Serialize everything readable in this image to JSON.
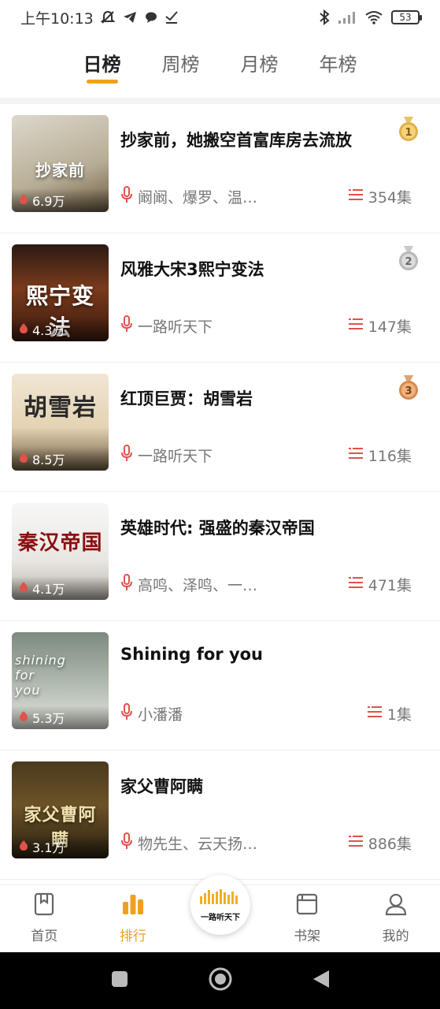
{
  "status_bar": {
    "time": "上午10:13",
    "battery": "53"
  },
  "tabs": [
    {
      "label": "日榜",
      "active": true
    },
    {
      "label": "周榜",
      "active": false
    },
    {
      "label": "月榜",
      "active": false
    },
    {
      "label": "年榜",
      "active": false
    }
  ],
  "items": [
    {
      "title": "抄家前，她搬空首富库房去流放",
      "plays": "6.9万",
      "authors": "阚阚、爆罗、温…",
      "episodes": "354集",
      "medal": "1",
      "medal_color": "#e2b04a",
      "cover_text": "抄家前",
      "cover_bg": "#c9c2b2"
    },
    {
      "title": "风雅大宋3熙宁变法",
      "plays": "4.3万",
      "authors": "一路听天下",
      "episodes": "147集",
      "medal": "2",
      "medal_color": "#b8b8b8",
      "cover_text": "熙宁变法",
      "cover_bg": "#5a2a16"
    },
    {
      "title": "红顶巨贾：胡雪岩",
      "plays": "8.5万",
      "authors": "一路听天下",
      "episodes": "116集",
      "medal": "3",
      "medal_color": "#d68a4f",
      "cover_text": "胡雪岩",
      "cover_bg": "#e9dcc6"
    },
    {
      "title": "英雄时代: 强盛的秦汉帝国",
      "plays": "4.1万",
      "authors": "高鸣、泽鸣、一…",
      "episodes": "471集",
      "medal": "",
      "medal_color": "",
      "cover_text": "秦汉帝国",
      "cover_bg": "#efefef"
    },
    {
      "title": "Shining for you",
      "plays": "5.3万",
      "authors": "小潘潘",
      "episodes": "1集",
      "medal": "",
      "medal_color": "",
      "cover_text": "shining for you",
      "cover_bg": "#9aa59a"
    },
    {
      "title": "家父曹阿瞒",
      "plays": "3.1万",
      "authors": "物先生、云天扬…",
      "episodes": "886集",
      "medal": "",
      "medal_color": "",
      "cover_text": "家父曹阿瞒",
      "cover_bg": "#3a3322"
    }
  ],
  "bottom_nav": [
    {
      "label": "首页",
      "icon": "bookmark-icon",
      "active": false
    },
    {
      "label": "排行",
      "icon": "bar-chart-icon",
      "active": true
    },
    {
      "label": "书架",
      "icon": "bookshelf-icon",
      "active": false
    },
    {
      "label": "我的",
      "icon": "user-icon",
      "active": false
    }
  ],
  "center_logo": {
    "text": "一路听天下"
  },
  "colors": {
    "accent": "#f0a020",
    "icon_red": "#e0524a"
  }
}
